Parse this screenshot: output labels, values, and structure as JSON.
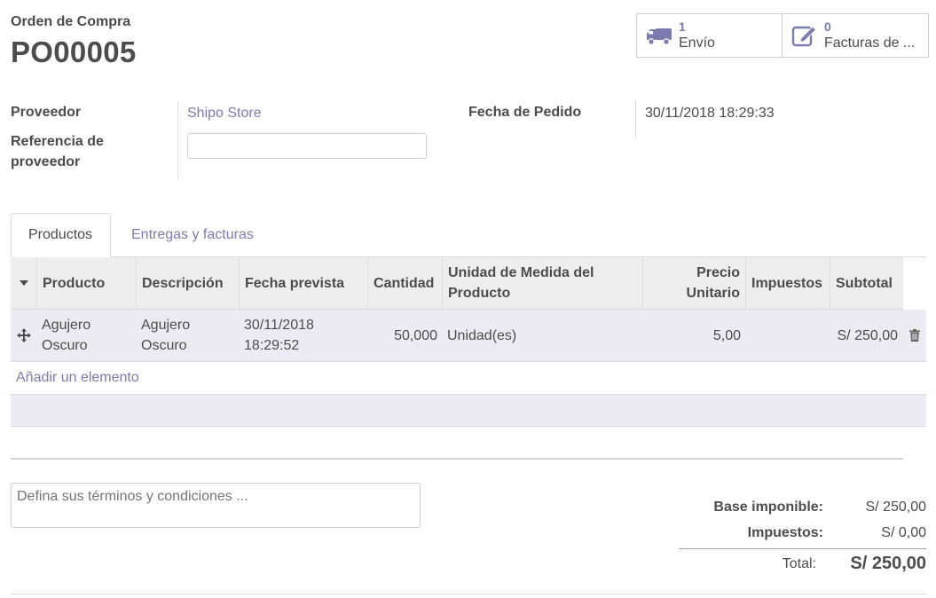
{
  "header": {
    "doc_label": "Orden de Compra",
    "doc_name": "PO00005"
  },
  "smart_buttons": {
    "shipping": {
      "count": "1",
      "label": "Envío",
      "icon": "truck-icon"
    },
    "invoices": {
      "count": "0",
      "label": "Facturas de ...",
      "icon": "edit-icon"
    }
  },
  "form": {
    "vendor_label": "Proveedor",
    "vendor_value": "Shipo Store",
    "vendor_ref_label": "Referencia de proveedor",
    "vendor_ref_value": "",
    "order_date_label": "Fecha de Pedido",
    "order_date_value": "30/11/2018 18:29:33"
  },
  "tabs": [
    {
      "label": "Productos",
      "active": true
    },
    {
      "label": "Entregas y facturas",
      "active": false
    }
  ],
  "table": {
    "columns": [
      "Producto",
      "Descripción",
      "Fecha prevista",
      "Cantidad",
      "Unidad de Medida del Producto",
      "Precio Unitario",
      "Impuestos",
      "Subtotal"
    ],
    "rows": [
      {
        "product": "Agujero Oscuro",
        "description": "Agujero Oscuro",
        "date": "30/11/2018 18:29:52",
        "quantity": "50,000",
        "uom": "Unidad(es)",
        "price": "5,00",
        "taxes": "",
        "subtotal": "S/ 250,00"
      }
    ],
    "add_line": "Añadir un elemento"
  },
  "notes": {
    "placeholder": "Defina sus términos y condiciones ..."
  },
  "totals": {
    "untaxed_label": "Base imponible:",
    "untaxed_value": "S/ 250,00",
    "taxes_label": "Impuestos:",
    "taxes_value": "S/ 0,00",
    "total_label": "Total:",
    "total_value": "S/ 250,00"
  },
  "colors": {
    "accent": "#7c7bad",
    "row_highlight": "#ebebf4",
    "header_bg": "#eeeeee"
  }
}
